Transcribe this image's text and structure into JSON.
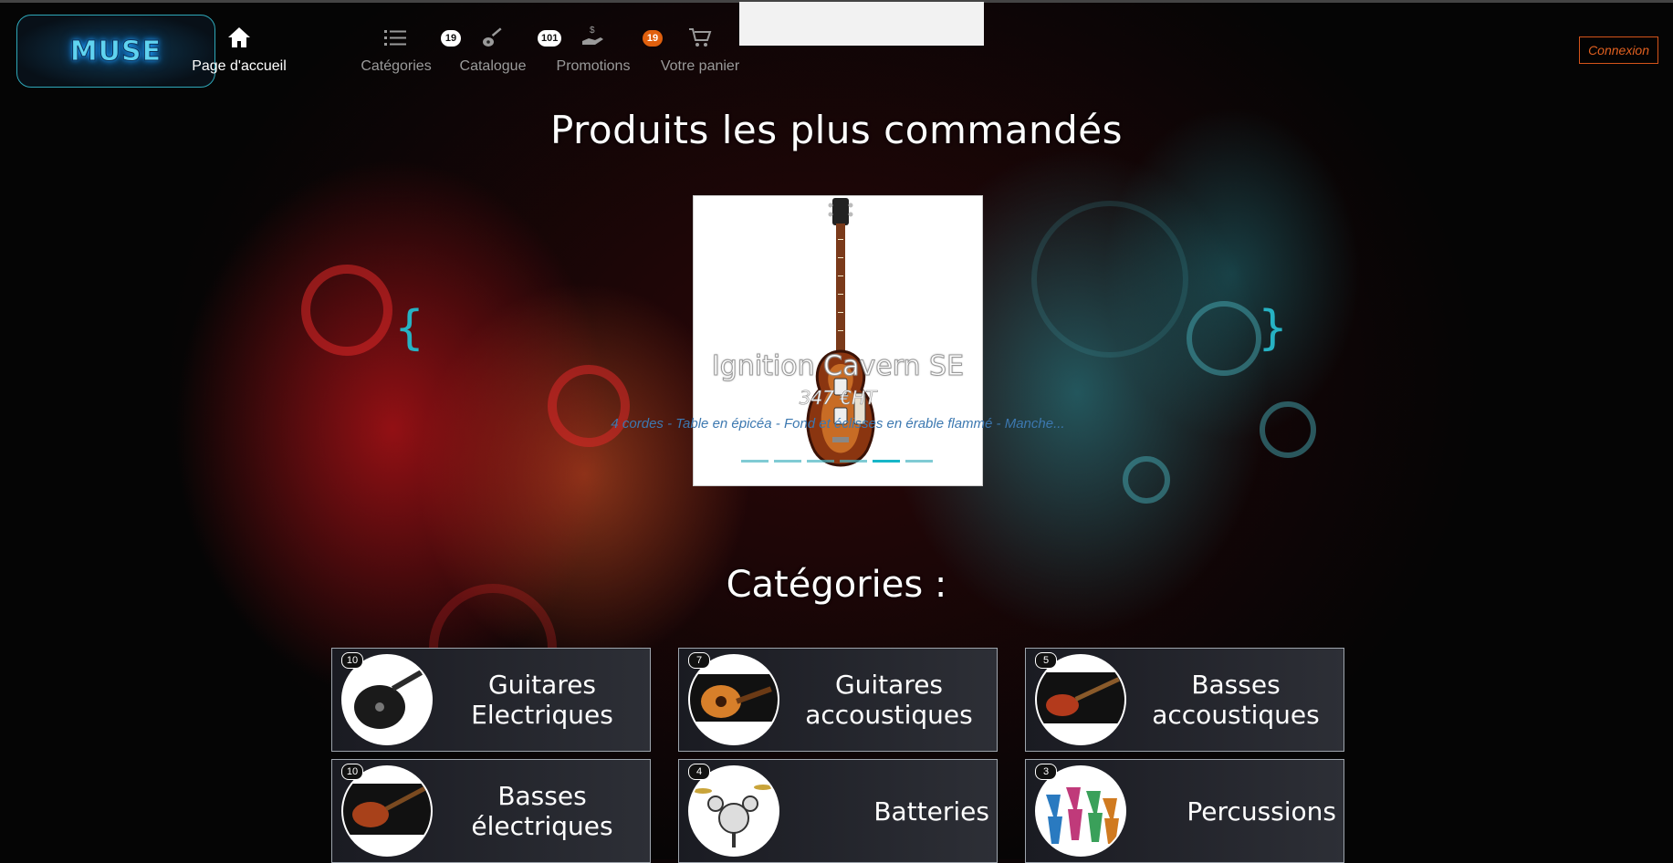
{
  "brand": {
    "logo_text": "MUSE"
  },
  "nav": [
    {
      "label": "Page d'accueil",
      "icon": "home-icon",
      "badge": null
    },
    {
      "label": "Catégories",
      "icon": "list-icon",
      "badge": "19"
    },
    {
      "label": "Catalogue",
      "icon": "guitar-icon",
      "badge": "101"
    },
    {
      "label": "Promotions",
      "icon": "price-hand-icon",
      "badge": "19"
    },
    {
      "label": "Votre panier",
      "icon": "cart-icon",
      "badge": null
    }
  ],
  "auth": {
    "login_label": "Connexion"
  },
  "featured": {
    "heading": "Produits les plus commandés",
    "product_name": "Ignition Cavern SE",
    "price": "347 €HT",
    "description": "4 cordes - Table en épicéa - Fond et éclisses en érable flammé - Manche...",
    "prev_label": "{",
    "next_label": "}",
    "slides": 6,
    "active_slide": 5
  },
  "categories": {
    "heading": "Catégories :",
    "items": [
      {
        "count": "10",
        "name": "Guitares Electriques",
        "thumb": "electric-guitar-thumbnail"
      },
      {
        "count": "7",
        "name": "Guitares accoustiques",
        "thumb": "acoustic-guitar-thumbnail"
      },
      {
        "count": "5",
        "name": "Basses accoustiques",
        "thumb": "acoustic-bass-thumbnail"
      },
      {
        "count": "10",
        "name": "Basses électriques",
        "thumb": "electric-bass-thumbnail"
      },
      {
        "count": "4",
        "name": "Batteries",
        "thumb": "drum-kit-thumbnail"
      },
      {
        "count": "3",
        "name": "Percussions",
        "thumb": "djembe-thumbnail"
      }
    ]
  },
  "colors": {
    "accent": "#17b6c8",
    "login": "#e06020",
    "badge_orange": "#e0600e"
  }
}
